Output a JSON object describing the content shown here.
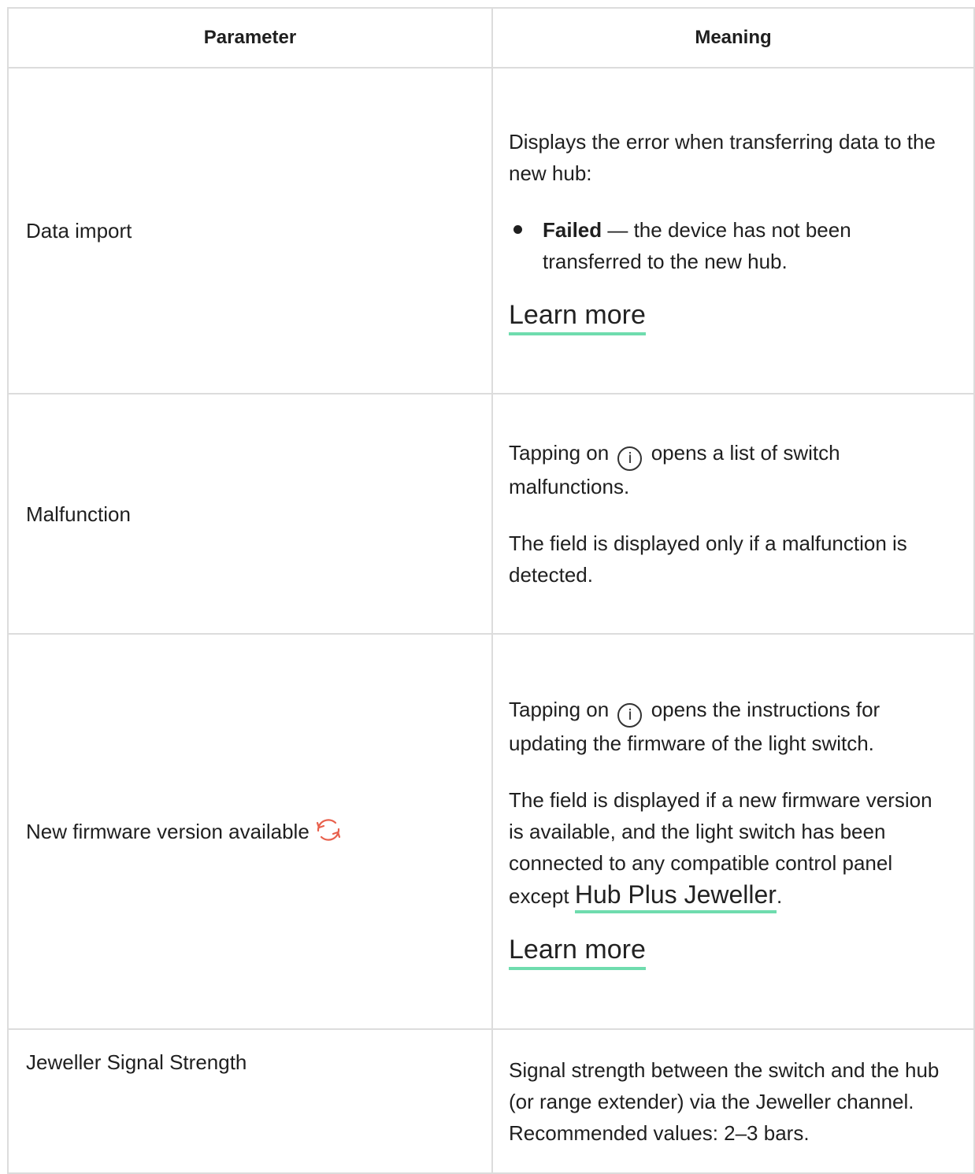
{
  "table": {
    "headers": {
      "parameter": "Parameter",
      "meaning": "Meaning"
    },
    "rows": [
      {
        "parameter": "Data import",
        "intro": "Displays the error when transferring data to the new hub:",
        "bullet_term": "Failed",
        "bullet_text": " — the device has not been transferred to the new hub.",
        "link": "Learn more"
      },
      {
        "parameter": "Malfunction",
        "p1_before": "Tapping on",
        "p1_after": "opens a list of switch malfunctions.",
        "p2": "The field is displayed only if a malfunction is detected."
      },
      {
        "parameter": "New firmware version available",
        "p1_before": "Tapping on",
        "p1_after": "opens the instructions for updating the firmware of the light switch.",
        "p2_before": "The field is displayed if a new firmware version is available, and the light switch has been connected to any compatible control panel except ",
        "p2_link": "Hub Plus Jeweller",
        "p2_after": ".",
        "link": "Learn more"
      },
      {
        "parameter": "Jeweller Signal Strength",
        "p1": "Signal strength between the switch and the hub (or range extender) via the Jeweller channel. Recommended values: 2–3 bars."
      }
    ]
  },
  "icons": {
    "info": {
      "name": "info-icon",
      "glyph": "i"
    },
    "sync": {
      "name": "sync-icon",
      "color": "#e8604c"
    }
  },
  "colors": {
    "link_underline": "#6fdcae",
    "border": "#dcdcdc"
  }
}
